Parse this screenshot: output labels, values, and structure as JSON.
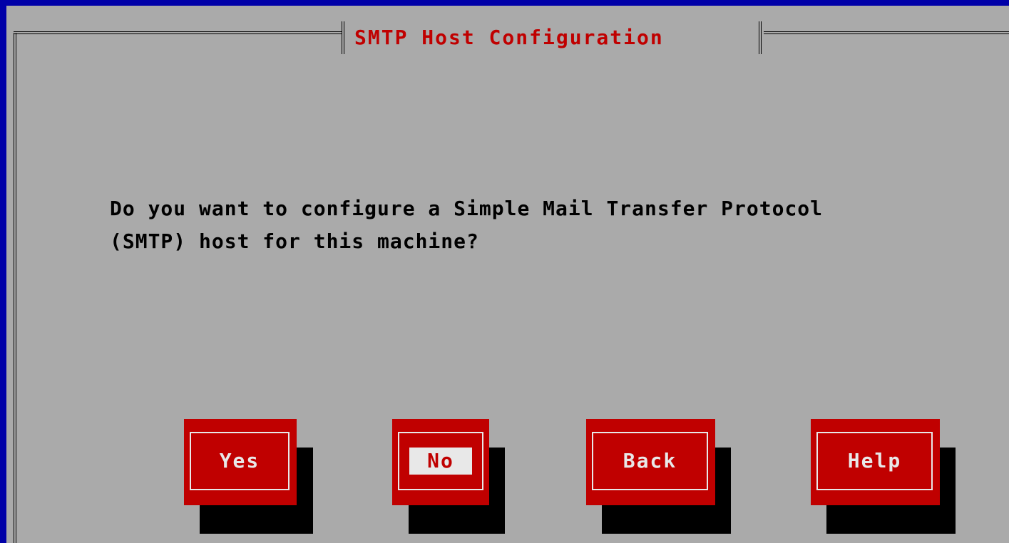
{
  "dialog": {
    "title": "SMTP Host Configuration",
    "message_line_1": "Do you want to configure a Simple Mail Transfer Protocol",
    "message_line_2": "(SMTP) host for this machine?"
  },
  "buttons": {
    "yes": "Yes",
    "no": "No",
    "back": "Back",
    "help": "Help"
  },
  "focused_button": "No",
  "colors": {
    "background": "#0000a8",
    "dialog": "#aaaaaa",
    "title_text": "#c00000",
    "button": "#c00000",
    "button_text": "#e8e8e8",
    "shadow": "#000000"
  }
}
